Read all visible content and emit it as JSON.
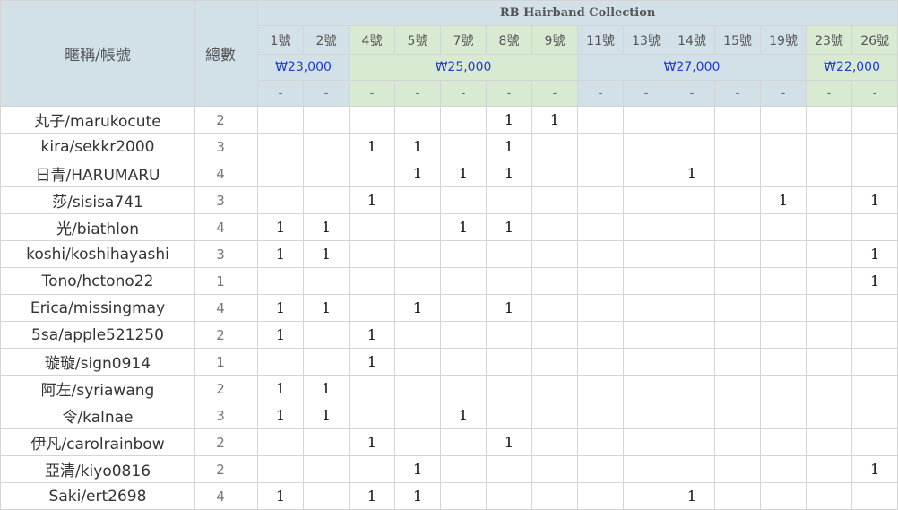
{
  "header": {
    "name_col": "暱稱/帳號",
    "total_col": "總數",
    "collection_title": "RB Hairband Collection",
    "numbers": [
      "1號",
      "2號",
      "4號",
      "5號",
      "7號",
      "8號",
      "9號",
      "11號",
      "13號",
      "14號",
      "15號",
      "19號",
      "23號",
      "26號"
    ],
    "prices": [
      {
        "label": "₩23,000",
        "span": 2,
        "color": "blue"
      },
      {
        "label": "₩25,000",
        "span": 5,
        "color": "green"
      },
      {
        "label": "₩27,000",
        "span": 5,
        "color": "blue"
      },
      {
        "label": "₩22,000",
        "span": 2,
        "color": "green"
      }
    ],
    "dash": "-"
  },
  "rows": [
    {
      "name": "丸子/marukocute",
      "total": "2",
      "cells": [
        "",
        "",
        "",
        "",
        "",
        "1",
        "1",
        "",
        "",
        "",
        "",
        "",
        "",
        ""
      ]
    },
    {
      "name": "kira/sekkr2000",
      "total": "3",
      "cells": [
        "",
        "",
        "1",
        "1",
        "",
        "1",
        "",
        "",
        "",
        "",
        "",
        "",
        "",
        ""
      ]
    },
    {
      "name": "日青/HARUMARU",
      "total": "4",
      "cells": [
        "",
        "",
        "",
        "1",
        "1",
        "1",
        "",
        "",
        "",
        "1",
        "",
        "",
        "",
        ""
      ]
    },
    {
      "name": "莎/sisisa741",
      "total": "3",
      "cells": [
        "",
        "",
        "1",
        "",
        "",
        "",
        "",
        "",
        "",
        "",
        "",
        "1",
        "",
        "1"
      ]
    },
    {
      "name": "光/biathlon",
      "total": "4",
      "cells": [
        "1",
        "1",
        "",
        "",
        "1",
        "1",
        "",
        "",
        "",
        "",
        "",
        "",
        "",
        ""
      ]
    },
    {
      "name": "koshi/koshihayashi",
      "total": "3",
      "cells": [
        "1",
        "1",
        "",
        "",
        "",
        "",
        "",
        "",
        "",
        "",
        "",
        "",
        "",
        "1"
      ]
    },
    {
      "name": "Tono/hctono22",
      "total": "1",
      "cells": [
        "",
        "",
        "",
        "",
        "",
        "",
        "",
        "",
        "",
        "",
        "",
        "",
        "",
        "1"
      ]
    },
    {
      "name": "Erica/missingmay",
      "total": "4",
      "cells": [
        "1",
        "1",
        "",
        "1",
        "",
        "1",
        "",
        "",
        "",
        "",
        "",
        "",
        "",
        ""
      ]
    },
    {
      "name": "5sa/apple521250",
      "total": "2",
      "cells": [
        "1",
        "",
        "1",
        "",
        "",
        "",
        "",
        "",
        "",
        "",
        "",
        "",
        "",
        ""
      ]
    },
    {
      "name": "璇璇/sign0914",
      "total": "1",
      "cells": [
        "",
        "",
        "1",
        "",
        "",
        "",
        "",
        "",
        "",
        "",
        "",
        "",
        "",
        ""
      ]
    },
    {
      "name": "阿左/syriawang",
      "total": "2",
      "cells": [
        "1",
        "1",
        "",
        "",
        "",
        "",
        "",
        "",
        "",
        "",
        "",
        "",
        "",
        ""
      ]
    },
    {
      "name": "令/kalnae",
      "total": "3",
      "cells": [
        "1",
        "1",
        "",
        "",
        "1",
        "",
        "",
        "",
        "",
        "",
        "",
        "",
        "",
        ""
      ]
    },
    {
      "name": "伊凡/carolrainbow",
      "total": "2",
      "cells": [
        "",
        "",
        "1",
        "",
        "",
        "1",
        "",
        "",
        "",
        "",
        "",
        "",
        "",
        ""
      ]
    },
    {
      "name": "亞清/kiyo0816",
      "total": "2",
      "cells": [
        "",
        "",
        "",
        "1",
        "",
        "",
        "",
        "",
        "",
        "",
        "",
        "",
        "",
        "1"
      ]
    },
    {
      "name": "Saki/ert2698",
      "total": "4",
      "cells": [
        "1",
        "",
        "1",
        "1",
        "",
        "",
        "",
        "",
        "",
        "1",
        "",
        "",
        "",
        ""
      ]
    }
  ]
}
